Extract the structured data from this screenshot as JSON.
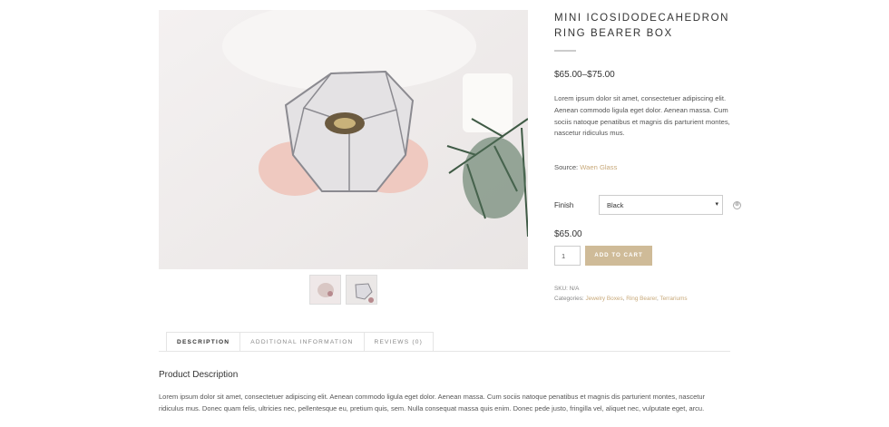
{
  "product": {
    "title": "Mini Icosidodecahedron Ring Bearer Box",
    "price_range": "$65.00–$75.00",
    "excerpt": "Lorem ipsum dolor sit amet, consectetuer adipiscing elit. Aenean commodo ligula eget dolor. Aenean massa. Cum sociis natoque penatibus et magnis dis parturient montes, nascetur ridiculus mus.",
    "source_label": "Source:",
    "source_link": "Waen Glass"
  },
  "variation": {
    "finish_label": "Finish",
    "finish_value": "Black",
    "arrow": "▾",
    "price": "$65.00"
  },
  "cart": {
    "quantity": "1",
    "add_to_cart_label": "Add to cart"
  },
  "meta": {
    "sku_label": "SKU:",
    "sku_value": "N/A",
    "categories_label": "Categories:",
    "categories": [
      "Jewelry Boxes",
      "Ring Bearer",
      "Terrariums"
    ]
  },
  "tabs": [
    {
      "label": "Description"
    },
    {
      "label": "Additional Information"
    },
    {
      "label": "Reviews (0)"
    }
  ],
  "description": {
    "heading": "Product Description",
    "body": "Lorem ipsum dolor sit amet, consectetuer adipiscing elit. Aenean commodo ligula eget dolor. Aenean massa. Cum sociis natoque penatibus et magnis dis parturient montes, nascetur ridiculus mus. Donec quam felis, ultricies nec, pellentesque eu, pretium quis, sem. Nulla consequat massa quis enim. Donec pede justo, fringilla vel, aliquet nec, vulputate eget, arcu."
  },
  "icons": {
    "clear": "⊗"
  }
}
